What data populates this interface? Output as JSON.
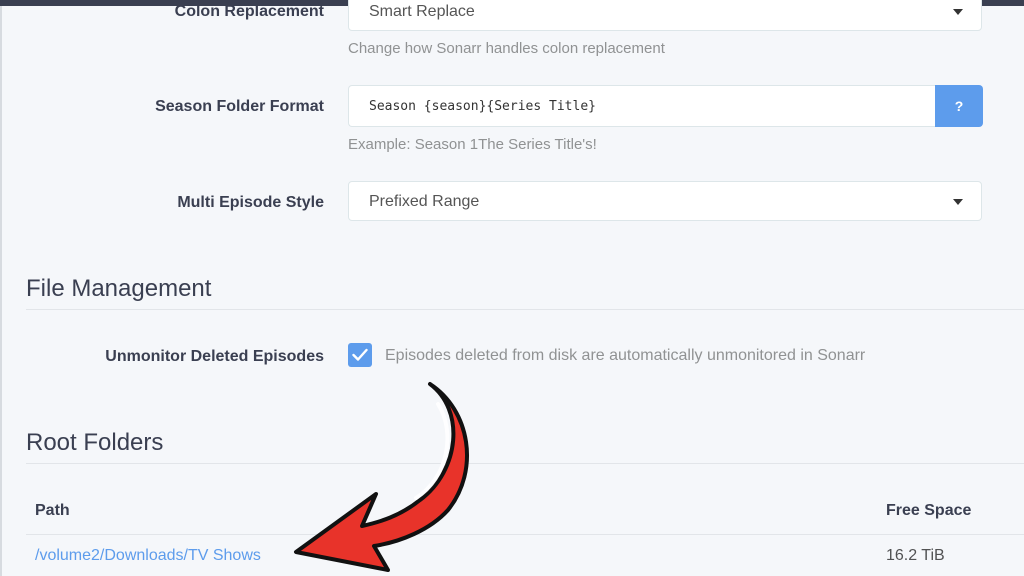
{
  "colors": {
    "accent": "#5d9cec",
    "annotation_arrow": "#e8332a",
    "label": "#3a3f51",
    "help_text": "#909293"
  },
  "episode_naming": {
    "colon_replacement": {
      "label": "Colon Replacement",
      "selected": "Smart Replace",
      "help": "Change how Sonarr handles colon replacement"
    },
    "season_folder_format": {
      "label": "Season Folder Format",
      "value": "Season {season}{Series Title}",
      "help_button": "?",
      "example": "Example: Season 1The Series Title's!"
    },
    "multi_episode_style": {
      "label": "Multi Episode Style",
      "selected": "Prefixed Range"
    }
  },
  "file_management": {
    "title": "File Management",
    "unmonitor_deleted": {
      "label": "Unmonitor Deleted Episodes",
      "checked": true,
      "help": "Episodes deleted from disk are automatically unmonitored in Sonarr"
    }
  },
  "root_folders": {
    "title": "Root Folders",
    "columns": {
      "path": "Path",
      "free_space": "Free Space"
    },
    "rows": [
      {
        "path": "/volume2/Downloads/TV Shows",
        "free_space": "16.2 TiB"
      }
    ]
  },
  "icons": {
    "dropdown": "caret-down-icon",
    "checkbox": "checkmark-icon",
    "annotation": "curved-arrow-icon"
  }
}
